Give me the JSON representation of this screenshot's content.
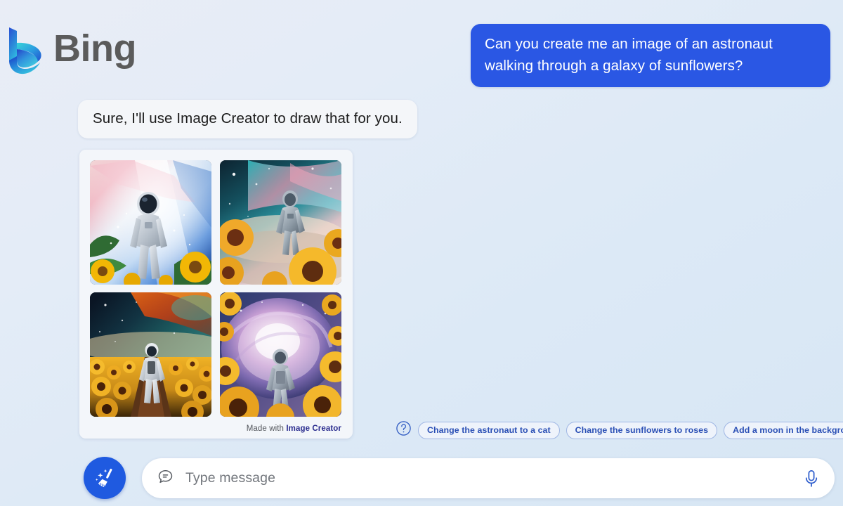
{
  "brand": {
    "name": "Bing",
    "logo_icon": "bing-b-logo-icon"
  },
  "colors": {
    "user_bubble": "#2a57e4",
    "bot_bubble": "#f4f6f9",
    "accent_blue": "#2a4fb5",
    "sweep_button": "#1f5ae0",
    "background_from": "#e9edf6",
    "background_to": "#d7e6f4"
  },
  "conversation": {
    "user_message": "Can you create me an image of an astronaut walking through a galaxy of sunflowers?",
    "bot_message": "Sure, I'll use Image Creator to draw that for you."
  },
  "image_card": {
    "footer_prefix": "Made with",
    "footer_link": "Image Creator",
    "images": [
      {
        "alt": "Astronaut in white suit standing amid sunflower leaves before a bright pink and blue galaxy light beam"
      },
      {
        "alt": "Astronaut walking away toward a teal and pink nebula with large sunflowers in the foreground"
      },
      {
        "alt": "Astronaut walking down a path through a dense field of sunflowers under an orange cosmic sky"
      },
      {
        "alt": "Astronaut walking into a glowing purple galaxy vortex framed by bright yellow sunflowers"
      }
    ]
  },
  "suggestions": {
    "help_icon": "question-mark-circle-icon",
    "chips": [
      "Change the astronaut to a cat",
      "Change the sunflowers to roses",
      "Add a moon in the background"
    ]
  },
  "composer": {
    "sweep_icon": "broom-sparkle-icon",
    "chat_icon": "chat-bubble-icon",
    "input_value": "",
    "input_placeholder": "Type message",
    "mic_icon": "microphone-icon"
  }
}
